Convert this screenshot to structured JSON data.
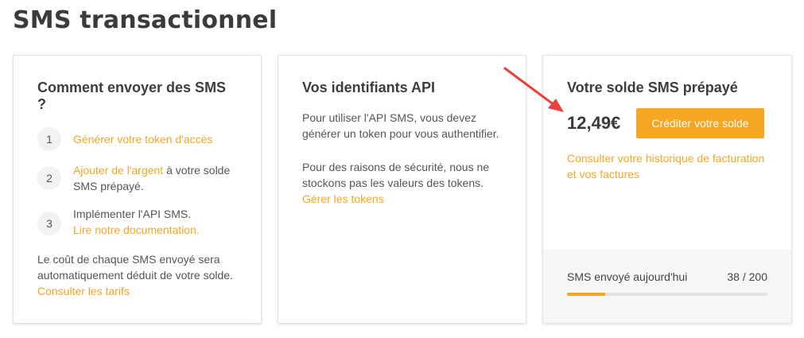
{
  "page": {
    "title": "SMS transactionnel"
  },
  "card_how_to": {
    "title": "Comment envoyer des SMS ?",
    "steps": [
      {
        "number": "1",
        "link": "Générer votre token d'accès",
        "text": ""
      },
      {
        "number": "2",
        "link": "Ajouter de l'argent",
        "text": " à votre solde SMS prépayé."
      },
      {
        "number": "3",
        "text": "Implémenter l'API SMS.",
        "link": "Lire notre documentation."
      }
    ],
    "footer_text": "Le coût de chaque SMS envoyé sera automatiquement déduit de votre solde. ",
    "footer_link": "Consulter les tarifs"
  },
  "card_api": {
    "title": "Vos identifiants API",
    "paragraph1": "Pour utiliser l'API SMS, vous devez générer un token pour vous authentifier.",
    "paragraph2": "Pour des raisons de sécurité, nous ne stockons pas les valeurs des tokens. ",
    "paragraph2_link": "Gérer les tokens"
  },
  "card_balance": {
    "title": "Votre solde SMS prépayé",
    "balance": "12,49€",
    "credit_button": "Créditer votre solde",
    "history_link": "Consulter votre historique de facturation et vos factures",
    "sent_label": "SMS envoyé aujourd'hui",
    "sent_count": "38 / 200",
    "sent_today": 38,
    "sent_limit": 200
  },
  "colors": {
    "accent": "#f5a623",
    "annotation_arrow": "#e8403b"
  }
}
